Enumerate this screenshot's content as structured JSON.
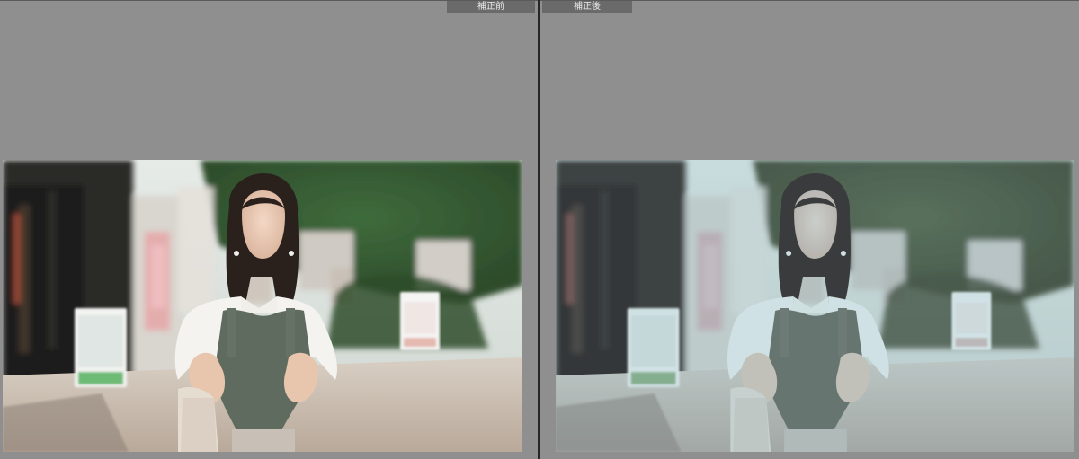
{
  "panes": {
    "before": {
      "label": "補正前"
    },
    "after": {
      "label": "補正後"
    }
  }
}
